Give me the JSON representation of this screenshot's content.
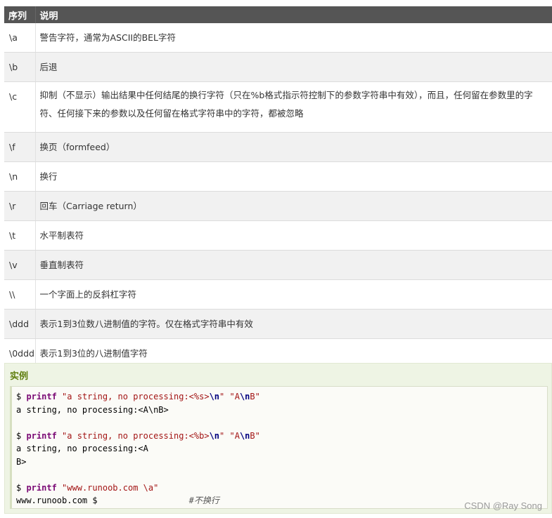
{
  "table": {
    "headers": [
      "序列",
      "说明"
    ],
    "rows": [
      {
        "seq": "\\a",
        "desc": "警告字符，通常为ASCII的BEL字符"
      },
      {
        "seq": "\\b",
        "desc": "后退"
      },
      {
        "seq": "\\c",
        "desc": "抑制（不显示）输出结果中任何结尾的换行字符（只在%b格式指示符控制下的参数字符串中有效），而且，任何留在参数里的字符、任何接下来的参数以及任何留在格式字符串中的字符，都被忽略"
      },
      {
        "seq": "\\f",
        "desc": "换页（formfeed）"
      },
      {
        "seq": "\\n",
        "desc": "换行"
      },
      {
        "seq": "\\r",
        "desc": "回车（Carriage return）"
      },
      {
        "seq": "\\t",
        "desc": "水平制表符"
      },
      {
        "seq": "\\v",
        "desc": "垂直制表符"
      },
      {
        "seq": "\\\\",
        "desc": "一个字面上的反斜杠字符"
      },
      {
        "seq": "\\ddd",
        "desc": "表示1到3位数八进制值的字符。仅在格式字符串中有效"
      },
      {
        "seq": "\\0ddd",
        "desc": "表示1到3位的八进制值字符"
      }
    ]
  },
  "example": {
    "title": "实例",
    "lines": [
      {
        "prompt": "$ ",
        "cmd": "printf",
        "sp": " ",
        "arg1a": "\"a string, no processing:<%s>",
        "arg1esc": "\\n",
        "arg1b": "\"",
        "sp2": " ",
        "arg2a": "\"A",
        "arg2esc": "\\n",
        "arg2b": "B\""
      },
      {
        "text": "a string, no processing:<A\\nB>"
      },
      {
        "text": ""
      },
      {
        "prompt": "$ ",
        "cmd": "printf",
        "sp": " ",
        "arg1a": "\"a string, no processing:<%b>",
        "arg1esc": "\\n",
        "arg1b": "\"",
        "sp2": " ",
        "arg2a": "\"A",
        "arg2esc": "\\n",
        "arg2b": "B\""
      },
      {
        "text": "a string, no processing:<A"
      },
      {
        "text": "B>"
      },
      {
        "text": ""
      },
      {
        "prompt": "$ ",
        "cmd": "printf",
        "sp": " ",
        "arg1a": "\"www.runoob.com \\a\""
      },
      {
        "text": "www.runoob.com $",
        "comment": "#不换行"
      }
    ]
  },
  "watermark": "CSDN @Ray Song"
}
